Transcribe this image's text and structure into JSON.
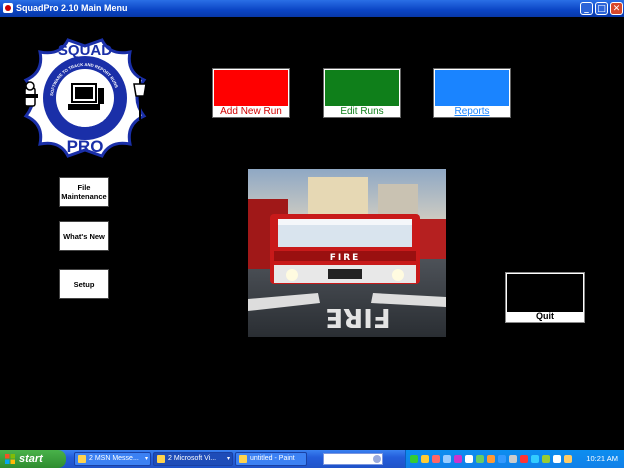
{
  "window": {
    "title": "SquadPro 2.10 Main Menu"
  },
  "logo": {
    "top_text": "SQUAD",
    "bottom_text": "PRO",
    "ring_text_top": "SOFTWARE TO TRACK AND REPORT RUNS",
    "ring_text_bottom": "MADE BY FIREMEN"
  },
  "main_buttons": {
    "add_new_run": "Add New Run",
    "edit_runs": "Edit Runs",
    "reports": "Reports"
  },
  "side_buttons": {
    "file_maintenance_line1": "File",
    "file_maintenance_line2": "Maintenance",
    "whats_new": "What's New",
    "setup": "Setup"
  },
  "photo": {
    "truck_text": "FIRE",
    "road_text": "FIRE"
  },
  "quit": {
    "label": "Quit"
  },
  "taskbar": {
    "start_label": "start",
    "tasks": [
      {
        "label": "2 MSN Messe...",
        "active": false
      },
      {
        "label": "2 Microsoft Vi...",
        "active": true
      },
      {
        "label": "untitled - Paint",
        "active": false
      }
    ],
    "clock": "10:21 AM"
  },
  "colors": {
    "add_new_run": "#ff0000",
    "edit_runs": "#0f7f1a",
    "reports": "#1a84ff",
    "background": "#000000",
    "logo_blue": "#1a2fa8"
  },
  "icons": [
    "window-app-icon",
    "minimize-icon",
    "maximize-icon",
    "close-icon",
    "windows-flag-icon",
    "hydrant-icon",
    "axe-icon",
    "computer-icon",
    "tray-icons"
  ]
}
